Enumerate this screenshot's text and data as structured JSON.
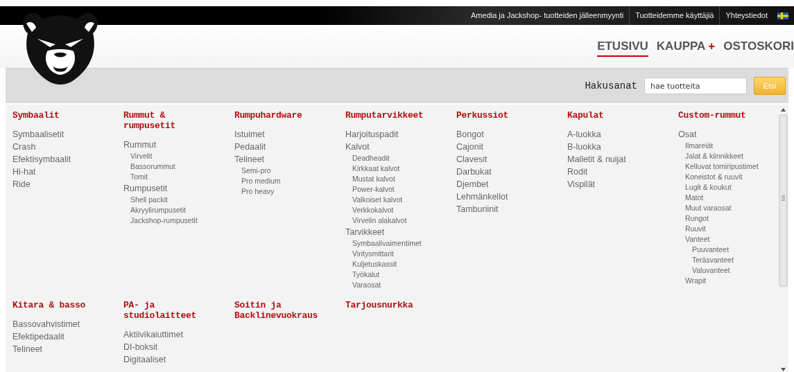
{
  "top_links": [
    {
      "label": "Amedia ja Jackshop- tuotteiden jälleenmyynti"
    },
    {
      "label": "Tuotteidemme käyttäjiä"
    },
    {
      "label": "Yhteystiedot"
    }
  ],
  "nav": [
    {
      "label": "ETUSIVU",
      "selected": true
    },
    {
      "label": "KAUPPA",
      "plus": "+",
      "selected": false
    },
    {
      "label": "OSTOSKORI",
      "selected": false
    }
  ],
  "search": {
    "label": "Hakusanat",
    "placeholder": "hae tuotteita",
    "button": "Etsi"
  },
  "categories": [
    {
      "title": "Symbaalit",
      "items": [
        {
          "label": "Symbaalisetit"
        },
        {
          "label": "Crash"
        },
        {
          "label": "Efektisymbaalit"
        },
        {
          "label": "Hi-hat"
        },
        {
          "label": "Ride"
        }
      ]
    },
    {
      "title": "Rummut & rumpusetit",
      "items": [
        {
          "label": "Rummut",
          "children": [
            {
              "label": "Virvelit"
            },
            {
              "label": "Bassorummut"
            },
            {
              "label": "Tomit"
            }
          ]
        },
        {
          "label": "Rumpusetit",
          "children": [
            {
              "label": "Shell packit"
            },
            {
              "label": "Akryylirumpusetit"
            },
            {
              "label": "Jackshop-rumpusetit"
            }
          ]
        }
      ]
    },
    {
      "title": "Rumpuhardware",
      "items": [
        {
          "label": "Istuimet"
        },
        {
          "label": "Pedaalit"
        },
        {
          "label": "Telineet",
          "children": [
            {
              "label": "Semi-pro"
            },
            {
              "label": "Pro medium"
            },
            {
              "label": "Pro heavy"
            }
          ]
        }
      ]
    },
    {
      "title": "Rumputarvikkeet",
      "items": [
        {
          "label": "Harjoituspadit"
        },
        {
          "label": "Kalvot",
          "children": [
            {
              "label": "Deadheadit"
            },
            {
              "label": "Kirkkaat kalvot"
            },
            {
              "label": "Mustat kalvot"
            },
            {
              "label": "Power-kalvot"
            },
            {
              "label": "Valkoiset kalvot"
            },
            {
              "label": "Verkkokalvot"
            },
            {
              "label": "Virvelin alakalvot"
            }
          ]
        },
        {
          "label": "Tarvikkeet",
          "children": [
            {
              "label": "Symbaalivaimentimet"
            },
            {
              "label": "Viritysmittarit"
            },
            {
              "label": "Kuljetuskassit"
            },
            {
              "label": "Työkalut"
            },
            {
              "label": "Varaosat"
            }
          ]
        }
      ]
    },
    {
      "title": "Perkussiot",
      "items": [
        {
          "label": "Bongot"
        },
        {
          "label": "Cajonit"
        },
        {
          "label": "Clavesit"
        },
        {
          "label": "Darbukat"
        },
        {
          "label": "Djembet"
        },
        {
          "label": "Lehmänkellot"
        },
        {
          "label": "Tamburiinit"
        }
      ]
    },
    {
      "title": "Kapulat",
      "items": [
        {
          "label": "A-luokka"
        },
        {
          "label": "B-luokka"
        },
        {
          "label": "Malletit & nuijat"
        },
        {
          "label": "Rodit"
        },
        {
          "label": "Vispilät"
        }
      ]
    },
    {
      "title": "Custom-rummut",
      "items": [
        {
          "label": "Osat",
          "children": [
            {
              "label": "Ilmareiät"
            },
            {
              "label": "Jalat & kiinnikkeet"
            },
            {
              "label": "Kelluvat tomiripustimet"
            },
            {
              "label": "Koneistot & ruuvit"
            },
            {
              "label": "Lugit & koukut"
            },
            {
              "label": "Matot"
            },
            {
              "label": "Muut varaosat"
            },
            {
              "label": "Rungot"
            },
            {
              "label": "Ruuvit"
            },
            {
              "label": "Vanteet",
              "children": [
                {
                  "label": "Puuvanteet"
                },
                {
                  "label": "Teräsvanteet"
                },
                {
                  "label": "Valuvanteet"
                }
              ]
            },
            {
              "label": "Wrapit"
            }
          ]
        }
      ]
    },
    {
      "title": "Kitara & basso",
      "items": [
        {
          "label": "Bassovahvistimet"
        },
        {
          "label": "Efektipedaalit"
        },
        {
          "label": "Telineet"
        }
      ]
    },
    {
      "title": "PA- ja studiolaitteet",
      "items": [
        {
          "label": "Aktiivikaiuttimet"
        },
        {
          "label": "DI-boksit"
        },
        {
          "label": "Digitaaliset"
        }
      ]
    },
    {
      "title": "Soitin ja Backlinevuokraus"
    },
    {
      "title": "Tarjousnurkka"
    }
  ]
}
